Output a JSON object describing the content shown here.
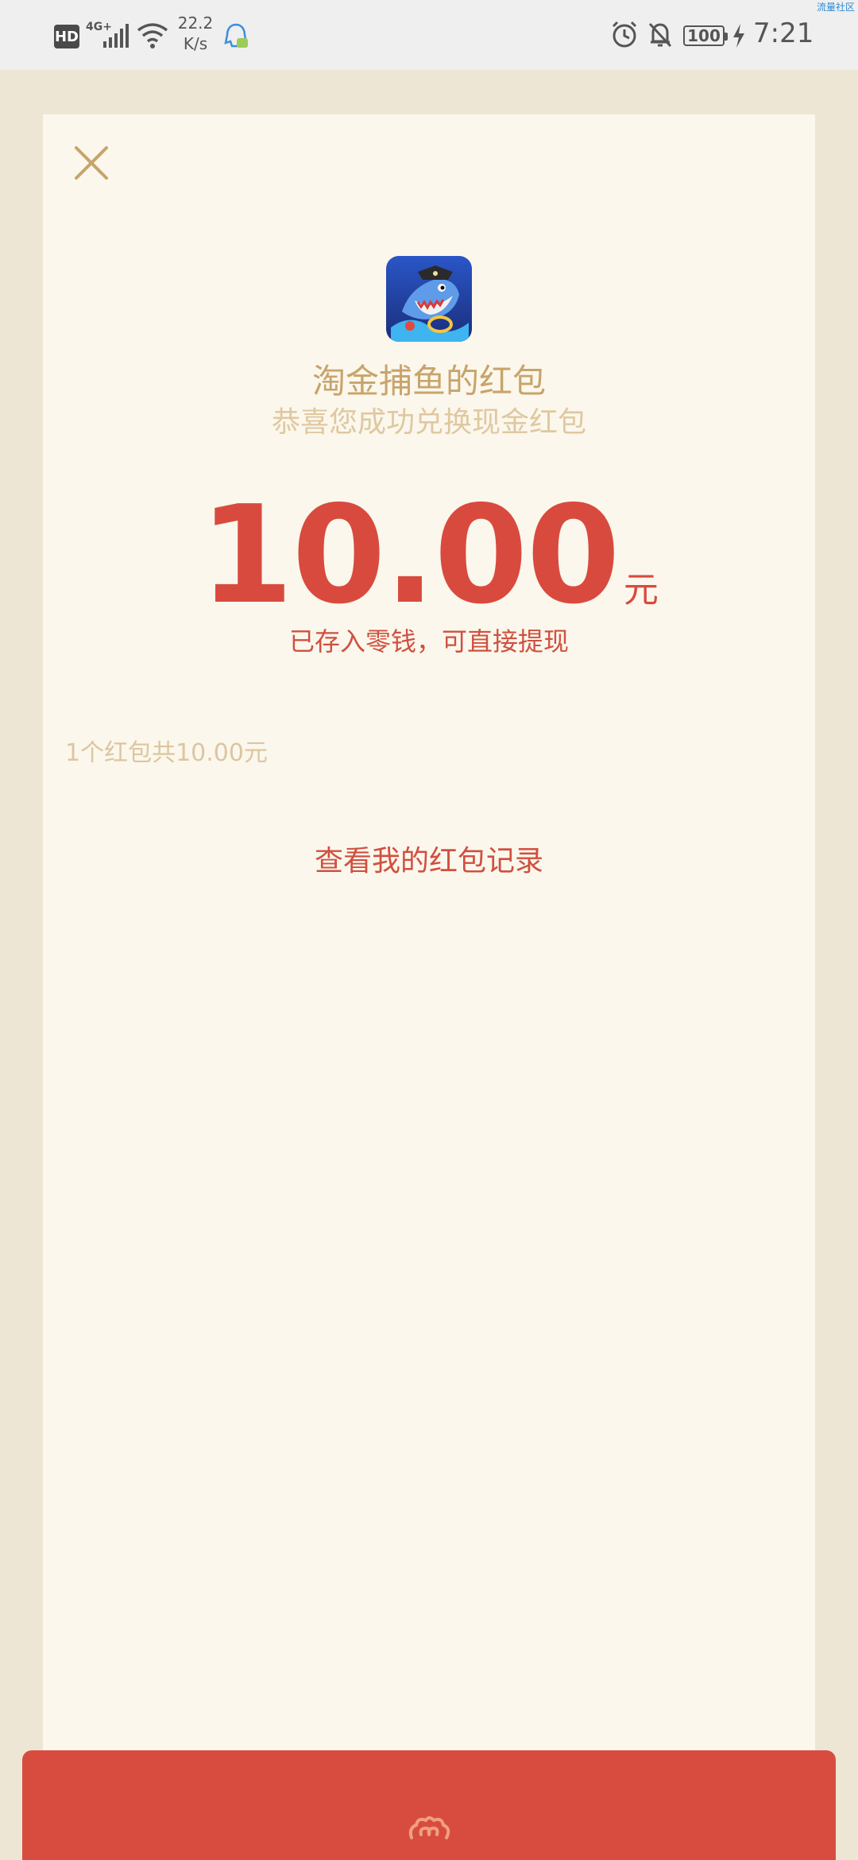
{
  "status_bar": {
    "hd": "HD",
    "network": "4G+",
    "speed_value": "22.2",
    "speed_unit": "K/s",
    "battery": "100",
    "time": "7:21",
    "watermark": "流量社区"
  },
  "app": {
    "icon": "shark-pirate-game-icon",
    "name": "淘金捕鱼的红包",
    "subtitle": "恭喜您成功兑换现金红包"
  },
  "amount": {
    "value": "10.00",
    "unit": "元",
    "note": "已存入零钱，可直接提现"
  },
  "summary": "1个红包共10.00元",
  "record_link": "查看我的红包记录",
  "colors": {
    "background": "#EEE6D5",
    "card": "#FBF7EC",
    "gold": "#C8A46B",
    "red": "#D94A3E"
  }
}
